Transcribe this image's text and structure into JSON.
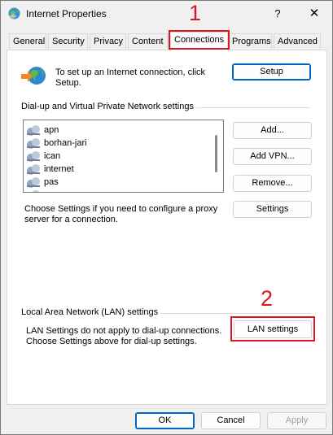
{
  "window": {
    "title": "Internet Properties",
    "help_glyph": "?",
    "close_glyph": "✕"
  },
  "tabs": [
    {
      "label": "General"
    },
    {
      "label": "Security"
    },
    {
      "label": "Privacy"
    },
    {
      "label": "Content"
    },
    {
      "label": "Connections",
      "active": true
    },
    {
      "label": "Programs"
    },
    {
      "label": "Advanced"
    }
  ],
  "annotations": {
    "step1": "1",
    "step2": "2",
    "highlight_color": "#e0141e"
  },
  "setup": {
    "description": "To set up an Internet connection, click Setup.",
    "button": "Setup"
  },
  "dialup": {
    "heading": "Dial-up and Virtual Private Network settings",
    "connections": [
      "apn",
      "borhan-jari",
      "ican",
      "internet",
      "pas"
    ],
    "add_button": "Add...",
    "add_vpn_button": "Add VPN...",
    "remove_button": "Remove...",
    "settings_text": "Choose Settings if you need to configure a proxy server for a connection.",
    "settings_button": "Settings"
  },
  "lan": {
    "heading": "Local Area Network (LAN) settings",
    "text": "LAN Settings do not apply to dial-up connections. Choose Settings above for dial-up settings.",
    "button": "LAN settings"
  },
  "footer": {
    "ok": "OK",
    "cancel": "Cancel",
    "apply": "Apply"
  },
  "colors": {
    "accent": "#0067c0",
    "annotation": "#e0141e"
  }
}
